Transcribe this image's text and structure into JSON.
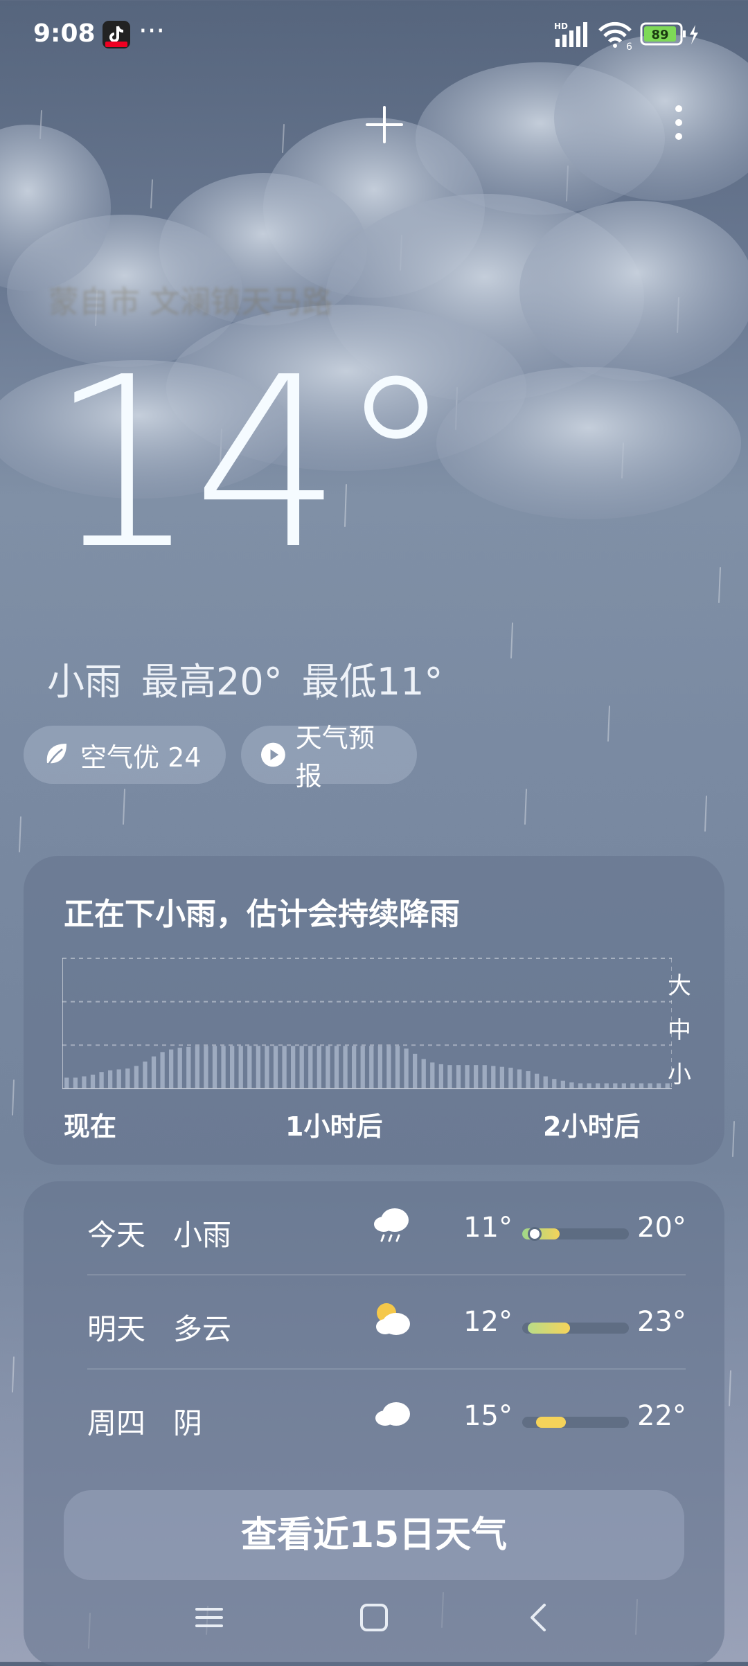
{
  "status_bar": {
    "time": "9:08",
    "more_dots": "···",
    "network_label": "HD",
    "wifi_label": "6",
    "battery": "89"
  },
  "header": {
    "blurred_location": "蒙自市 文澜镇天马路"
  },
  "current": {
    "temperature": "14°",
    "condition": "小雨",
    "high": "最高20°",
    "low": "最低11°"
  },
  "chips": {
    "aqi_label": "空气优 24",
    "forecast_label": "天气预报"
  },
  "rain_card": {
    "title": "正在下小雨，估计会持续降雨",
    "levels": [
      "大",
      "中",
      "小"
    ],
    "x_labels": [
      "现在",
      "1小时后",
      "2小时后"
    ]
  },
  "chart_data": {
    "type": "bar",
    "title": "正在下小雨，估计会持续降雨",
    "y_levels": [
      "小",
      "中",
      "大"
    ],
    "x_ticks": [
      "现在",
      "1小时后",
      "2小时后"
    ],
    "ylim": [
      0,
      3
    ],
    "values": [
      0.25,
      0.25,
      0.28,
      0.32,
      0.38,
      0.42,
      0.44,
      0.46,
      0.52,
      0.62,
      0.74,
      0.84,
      0.9,
      0.94,
      0.96,
      0.98,
      0.98,
      0.98,
      0.98,
      0.98,
      0.98,
      0.98,
      0.98,
      0.98,
      0.98,
      0.98,
      0.98,
      0.98,
      0.98,
      0.98,
      0.98,
      0.98,
      0.98,
      0.98,
      0.98,
      0.98,
      0.98,
      0.98,
      0.98,
      0.92,
      0.8,
      0.68,
      0.6,
      0.56,
      0.54,
      0.54,
      0.54,
      0.54,
      0.54,
      0.52,
      0.5,
      0.48,
      0.44,
      0.4,
      0.34,
      0.28,
      0.22,
      0.18,
      0.14,
      0.12,
      0.12,
      0.12,
      0.12,
      0.12,
      0.12,
      0.12,
      0.12,
      0.12,
      0.12,
      0.12
    ]
  },
  "forecast": {
    "rows": [
      {
        "day": "今天",
        "weather": "小雨",
        "low": "11°",
        "high": "20°",
        "icon": "light-rain-icon",
        "range": [
          0.0,
          0.35
        ],
        "current": 0.12
      },
      {
        "day": "明天",
        "weather": "多云",
        "low": "12°",
        "high": "23°",
        "icon": "partly-cloudy-icon",
        "range": [
          0.05,
          0.45
        ]
      },
      {
        "day": "周四",
        "weather": "阴",
        "low": "15°",
        "high": "22°",
        "icon": "overcast-icon",
        "range": [
          0.13,
          0.41
        ]
      }
    ],
    "button_label": "查看近15日天气"
  },
  "colors": {
    "accent_green": "#9fd88a",
    "accent_yellow": "#f5d35a"
  }
}
